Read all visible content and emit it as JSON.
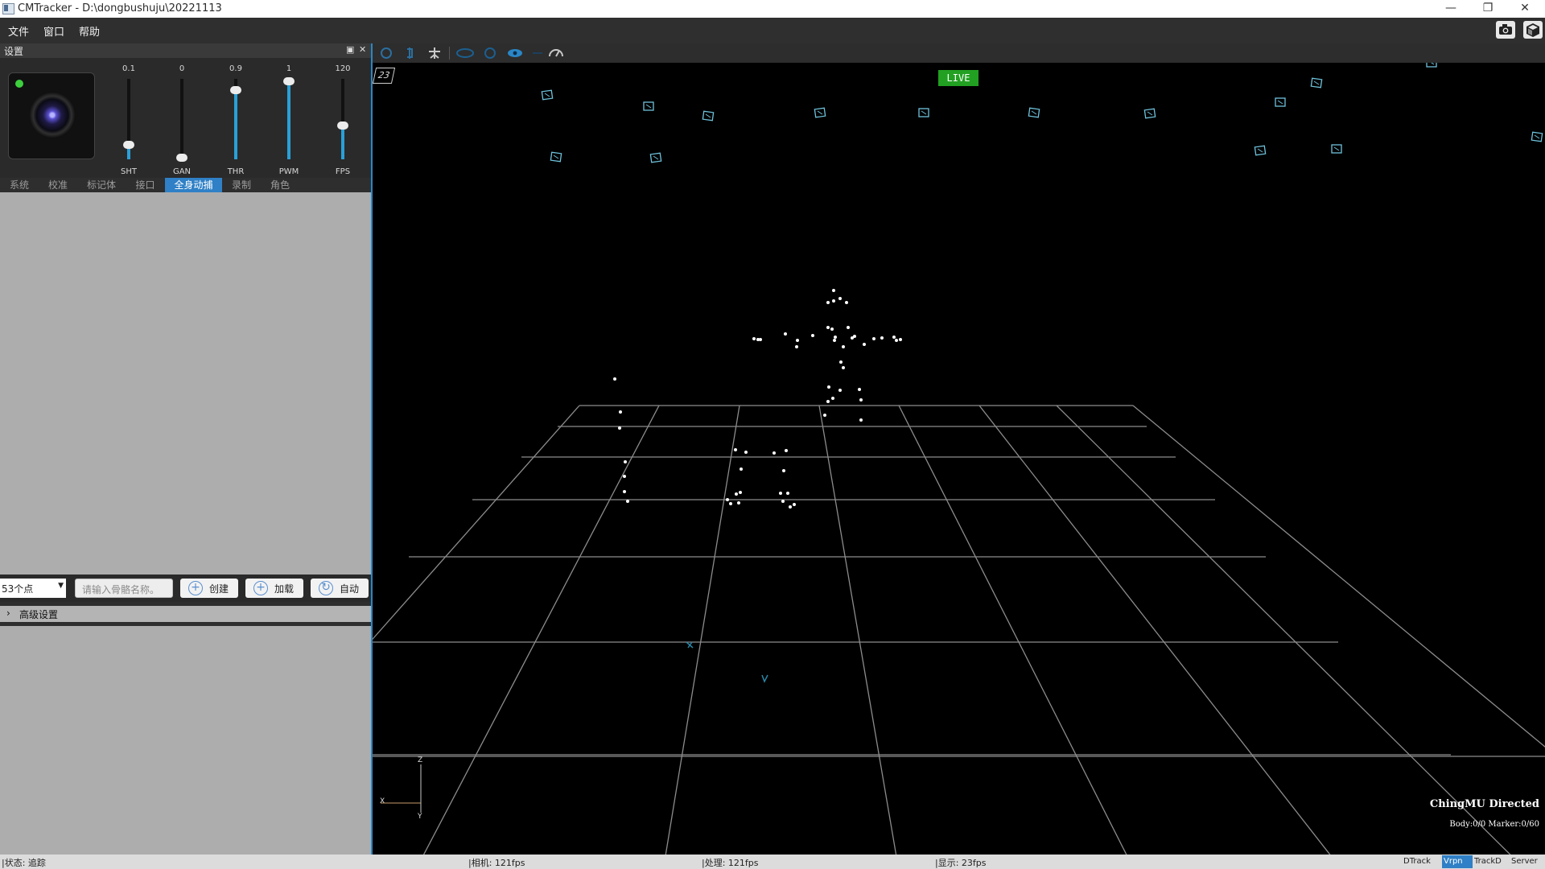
{
  "window": {
    "title": "CMTracker - D:\\dongbushuju\\20221113",
    "controls": {
      "minimize": "—",
      "restore": "❐",
      "close": "✕"
    }
  },
  "menu": [
    "文件",
    "窗口",
    "帮助"
  ],
  "toolbar_right": [
    "camera-icon",
    "cube-icon"
  ],
  "settings_panel": {
    "title": "设置",
    "float_icon": "▣",
    "close_icon": "✕",
    "camera": {
      "status_color": "#3ecf3e"
    },
    "sliders": [
      {
        "label": "SHT",
        "value": "0.1",
        "level": 0.18
      },
      {
        "label": "GAN",
        "value": "0",
        "level": 0.02
      },
      {
        "label": "THR",
        "value": "0.9",
        "level": 0.86
      },
      {
        "label": "PWM",
        "value": "1",
        "level": 0.97
      },
      {
        "label": "FPS",
        "value": "120",
        "level": 0.42
      }
    ],
    "tabs": [
      "系统",
      "校准",
      "标记体",
      "接口",
      "全身动捕",
      "录制",
      "角色"
    ],
    "active_tab": "全身动捕",
    "actions": {
      "point_select": "53个点",
      "name_placeholder": "请输入骨骼名称。",
      "create": "创建",
      "load": "加载",
      "auto": "自动"
    },
    "advanced": {
      "arrow": "›",
      "label": "高级设置"
    }
  },
  "viewport": {
    "live": "LIVE",
    "frame_indicator": "23",
    "axes": {
      "z": "Z",
      "x": "X",
      "y": "Y"
    },
    "overlay_title": "ChingMU Directed",
    "overlay_stats": "Body:0/0 Marker:0/60",
    "colors": {
      "grid": "#8c8c8c",
      "camera": "#6ec2dc",
      "marker": "#ffffff",
      "accent": "#2f80c6"
    }
  },
  "statusbar": {
    "status": "|状态: 追踪",
    "camera": "|相机: 121fps",
    "processing": "|处理: 121fps",
    "display": "|显示: 23fps",
    "pills": [
      "DTrack",
      "Vrpn",
      "TrackD",
      "Server"
    ],
    "active_pill": "Vrpn"
  }
}
